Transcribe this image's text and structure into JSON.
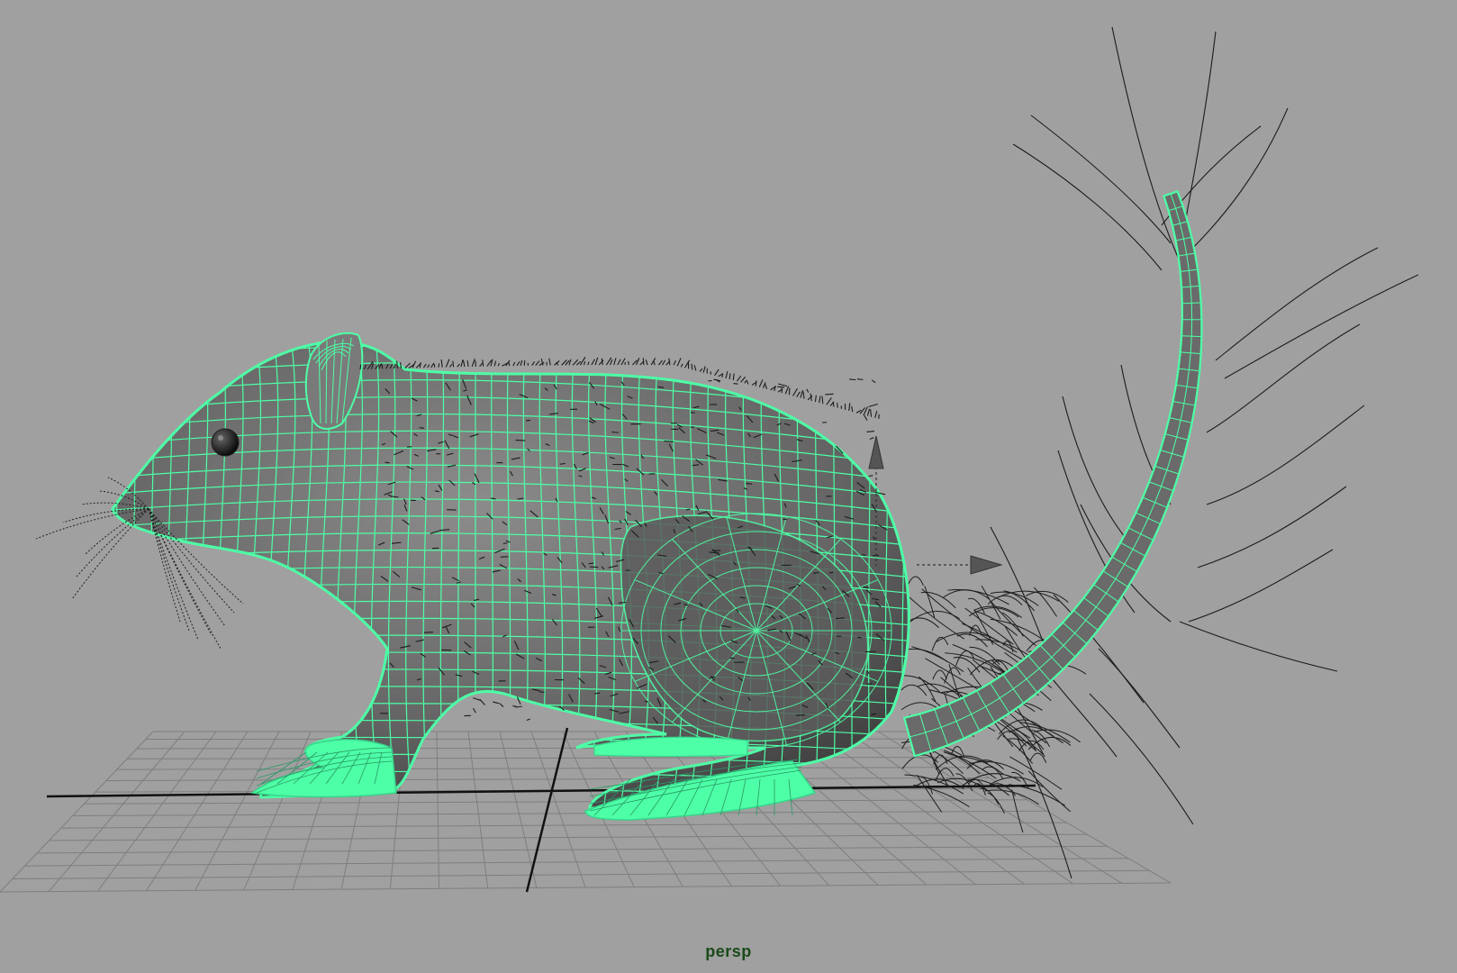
{
  "viewport": {
    "camera_name": "persp",
    "background_color": "#a0a0a0",
    "selection_wire_color": "#4dffa6",
    "mesh_color": "#6a6a6a",
    "grid_color": "#7e7e7e",
    "grid_axis_color": "#111111",
    "hair_color": "#1c1c1c"
  },
  "scene": {
    "object": "rat-model",
    "selected": true,
    "manipulator": "move-tool-gizmo"
  }
}
